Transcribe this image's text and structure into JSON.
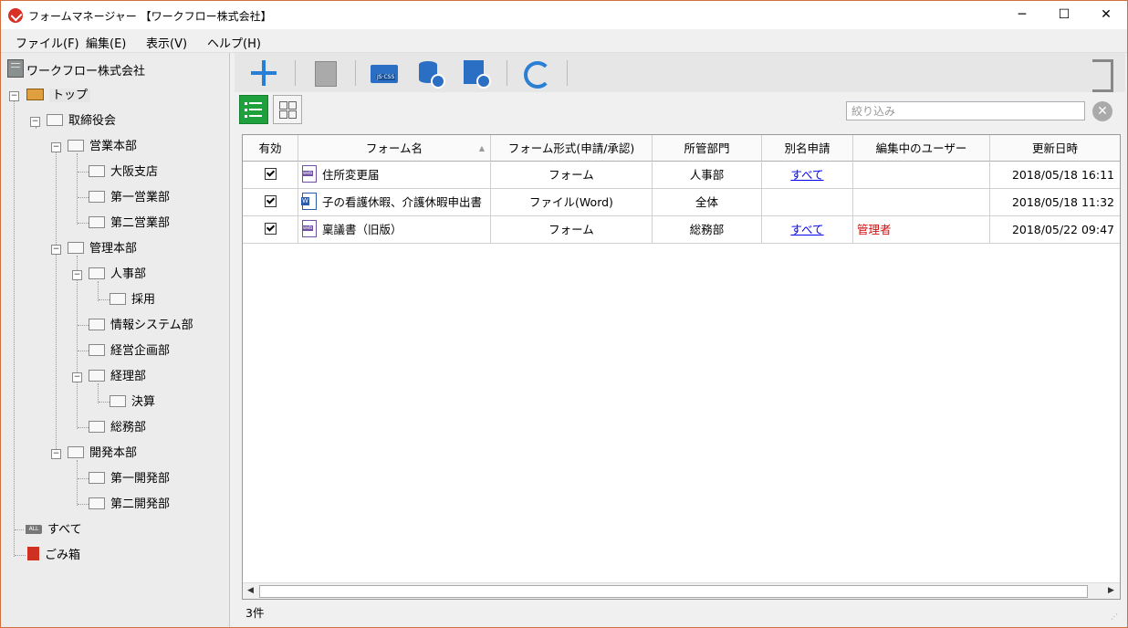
{
  "window": {
    "title": "フォームマネージャー 【ワークフロー株式会社】",
    "minimize": "─",
    "maximize": "☐",
    "close": "✕"
  },
  "menu": [
    "ファイル(F)",
    "編集(E)",
    "表示(V)",
    "ヘルプ(H)"
  ],
  "tree": {
    "company": "ワークフロー株式会社",
    "nodes": [
      {
        "label": "トップ"
      },
      {
        "label": "取締役会"
      },
      {
        "label": "営業本部"
      },
      {
        "label": "大阪支店"
      },
      {
        "label": "第一営業部"
      },
      {
        "label": "第二営業部"
      },
      {
        "label": "管理本部"
      },
      {
        "label": "人事部"
      },
      {
        "label": "採用"
      },
      {
        "label": "情報システム部"
      },
      {
        "label": "経営企画部"
      },
      {
        "label": "経理部"
      },
      {
        "label": "決算"
      },
      {
        "label": "総務部"
      },
      {
        "label": "開発本部"
      },
      {
        "label": "第一開発部"
      },
      {
        "label": "第二開発部"
      },
      {
        "label": "すべて"
      },
      {
        "label": "ごみ箱"
      }
    ],
    "all_badge": "ALL"
  },
  "toolbar": {
    "icons": [
      "add-icon",
      "copy-list-icon",
      "js-css-folder-icon",
      "database-settings-icon",
      "user-settings-icon",
      "refresh-icon",
      "exit-icon"
    ],
    "js_css_label": "JS·CSS",
    "accent": "#2a7fd4"
  },
  "filter": {
    "placeholder": "絞り込み",
    "value": ""
  },
  "table": {
    "headers": [
      "有効",
      "フォーム名",
      "フォーム形式(申請/承認)",
      "所管部門",
      "別名申請",
      "編集中のユーザー",
      "更新日時"
    ],
    "sort_indicator": "▲",
    "rows": [
      {
        "enabled": true,
        "icon": "web-form-icon",
        "name": "住所変更届",
        "format": "フォーム",
        "dept": "人事部",
        "alias": "すべて",
        "editing_user": "",
        "updated": "2018/05/18 16:11"
      },
      {
        "enabled": true,
        "icon": "word-file-icon",
        "name": "子の看護休暇、介護休暇申出書",
        "format": "ファイル(Word)",
        "dept": "全体",
        "alias": "",
        "editing_user": "",
        "updated": "2018/05/18 11:32"
      },
      {
        "enabled": true,
        "icon": "web-form-icon",
        "name": "稟議書（旧版）",
        "format": "フォーム",
        "dept": "総務部",
        "alias": "すべて",
        "editing_user": "管理者",
        "updated": "2018/05/22 09:47"
      }
    ]
  },
  "scroll": {
    "left": "◀",
    "right": "▶"
  },
  "status": {
    "count": "3件"
  }
}
